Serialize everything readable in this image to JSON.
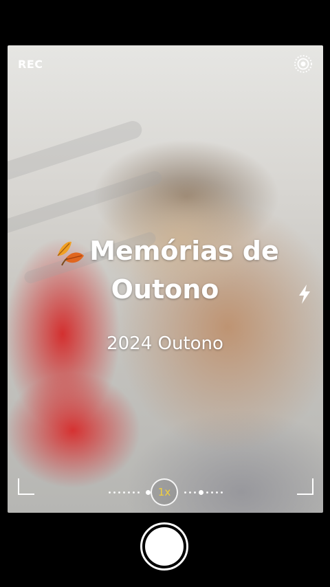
{
  "camera": {
    "rec_label": "REC",
    "live_icon": "live-photo-icon",
    "flash_icon": "flash-icon"
  },
  "overlay": {
    "leaf_icon": "autumn-leaves-icon",
    "title_line1": "Memórias de",
    "title_line2": "Outono",
    "subtitle": "2024 Outono"
  },
  "zoom": {
    "label": "1x",
    "accent": "#f2cf3d"
  },
  "shutter_icon": "shutter-button"
}
